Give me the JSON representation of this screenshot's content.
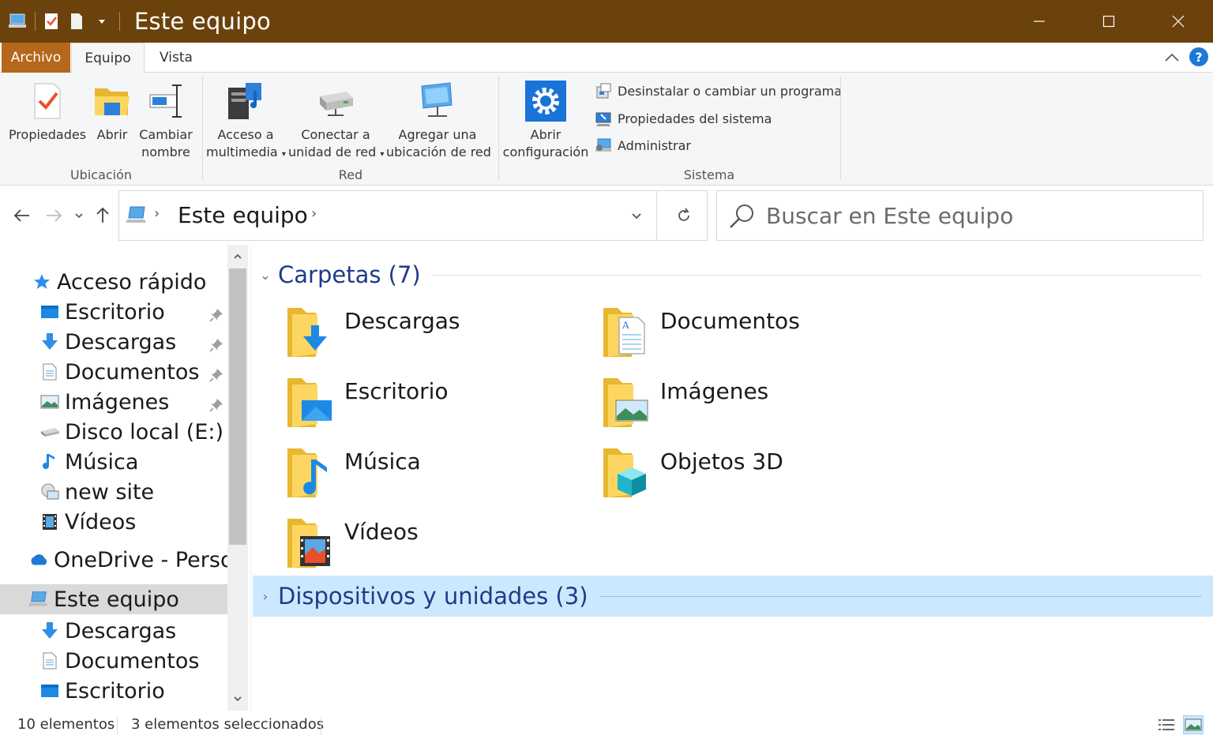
{
  "window": {
    "title": "Este equipo",
    "colors": {
      "titlebar": "#6b420c",
      "archivo_tab": "#b5681a",
      "accent": "#1e78d7",
      "selection": "#cce8ff"
    }
  },
  "ribbon": {
    "tabs": [
      {
        "label": "Archivo"
      },
      {
        "label": "Equipo"
      },
      {
        "label": "Vista"
      }
    ],
    "help": "?",
    "groups": {
      "ubicacion": {
        "label": "Ubicación",
        "buttons": [
          {
            "line1": "Propiedades",
            "line2": "",
            "icon": "properties-icon"
          },
          {
            "line1": "Abrir",
            "line2": "",
            "icon": "open-folder-icon"
          },
          {
            "line1": "Cambiar",
            "line2": "nombre",
            "icon": "rename-icon"
          }
        ]
      },
      "red": {
        "label": "Red",
        "buttons": [
          {
            "line1": "Acceso a",
            "line2": "multimedia",
            "icon": "media-server-icon"
          },
          {
            "line1": "Conectar a",
            "line2": "unidad de red",
            "icon": "network-drive-icon"
          },
          {
            "line1": "Agregar una",
            "line2": "ubicación de red",
            "icon": "network-location-icon"
          }
        ]
      },
      "sistema": {
        "label": "Sistema",
        "big_button": {
          "line1": "Abrir",
          "line2": "configuración",
          "icon": "settings-gear-icon"
        },
        "small_buttons": [
          {
            "label": "Desinstalar o cambiar un programa",
            "icon": "uninstall-icon"
          },
          {
            "label": "Propiedades del sistema",
            "icon": "system-properties-icon"
          },
          {
            "label": "Administrar",
            "icon": "computer-manage-icon"
          }
        ]
      }
    }
  },
  "address": {
    "crumb": "Este equipo",
    "search_placeholder": "Buscar en Este equipo"
  },
  "nav": {
    "quick_access": "Acceso rápido",
    "quick_items": [
      {
        "label": "Escritorio",
        "icon": "desktop-icon",
        "pinned": true
      },
      {
        "label": "Descargas",
        "icon": "download-arrow-icon",
        "pinned": true
      },
      {
        "label": "Documentos",
        "icon": "documents-icon",
        "pinned": true
      },
      {
        "label": "Imágenes",
        "icon": "pictures-icon",
        "pinned": true
      },
      {
        "label": "Disco local (E:)",
        "icon": "drive-icon",
        "pinned": false
      },
      {
        "label": "Música",
        "icon": "music-note-icon",
        "pinned": false
      },
      {
        "label": "new site",
        "icon": "network-share-icon",
        "pinned": false
      },
      {
        "label": "Vídeos",
        "icon": "film-icon",
        "pinned": false
      }
    ],
    "onedrive": "OneDrive - Perso",
    "this_pc": "Este equipo",
    "pc_items": [
      {
        "label": "Descargas",
        "icon": "download-arrow-icon"
      },
      {
        "label": "Documentos",
        "icon": "documents-icon"
      },
      {
        "label": "Escritorio",
        "icon": "desktop-icon"
      }
    ]
  },
  "content": {
    "folders_header": "Carpetas (7)",
    "folders": [
      {
        "name": "Descargas",
        "overlay": "download"
      },
      {
        "name": "Documentos",
        "overlay": "document"
      },
      {
        "name": "Escritorio",
        "overlay": "desktop"
      },
      {
        "name": "Imágenes",
        "overlay": "picture"
      },
      {
        "name": "Música",
        "overlay": "music"
      },
      {
        "name": "Objetos 3D",
        "overlay": "cube"
      },
      {
        "name": "Vídeos",
        "overlay": "film"
      }
    ],
    "devices_header": "Dispositivos y unidades (3)"
  },
  "status": {
    "count": "10 elementos",
    "selected": "3 elementos seleccionados"
  }
}
